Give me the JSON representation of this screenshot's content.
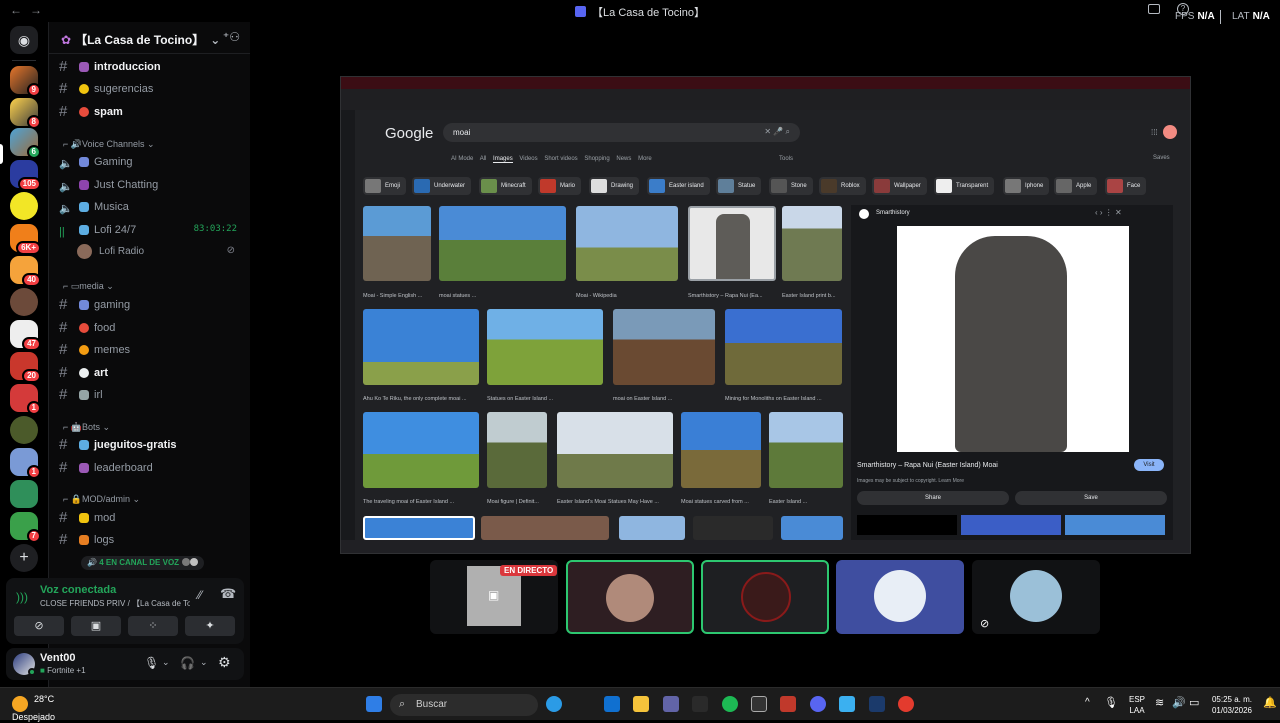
{
  "window": {
    "title": "【La Casa de Tocino】",
    "fps_label": "FPS",
    "fps_value": "N/A",
    "lat_label": "LAT",
    "lat_value": "N/A"
  },
  "rail_badges": [
    "9",
    "8",
    "6",
    "105",
    "6K+",
    "40",
    "47",
    "20",
    "1",
    "1",
    "7"
  ],
  "guild": {
    "name": "【La Casa de Tocino】"
  },
  "channels": {
    "introduccion": "introduccion",
    "sugerencias": "sugerencias",
    "spam": "spam",
    "voice_category": "Voice Channels",
    "gaming_voice": "Gaming",
    "just_chatting": "Just Chatting",
    "musica": "Musica",
    "lofi": "Lofi 24/7",
    "lofi_timer": "83:03:22",
    "lofi_radio": "Lofi Radio",
    "media_category": "media",
    "gaming_text": "gaming",
    "food": "food",
    "memes": "memes",
    "art": "art",
    "irl": "irl",
    "bots_category": "Bots",
    "jueguitos": "jueguitos-gratis",
    "leaderboard": "leaderboard",
    "mod_category": "MOD/admin",
    "mod": "mod",
    "logs": "logs",
    "voice_count": "4 EN CANAL DE VOZ"
  },
  "voice": {
    "status": "Voz conectada",
    "location": "CLOSE FRIENDS PRIV / 【La Casa de To..."
  },
  "user": {
    "name": "Vent00",
    "activity": "Fortnite +1"
  },
  "stream": {
    "live_label": "EN DIRECTO",
    "search_query": "moai",
    "google": "Google",
    "tabs": [
      "AI Mode",
      "All",
      "Images",
      "Videos",
      "Short videos",
      "Shopping",
      "News",
      "More",
      "Tools"
    ],
    "saves": "Saves",
    "chips": [
      "Emoji",
      "Underwater",
      "Minecraft",
      "Mario",
      "Drawing",
      "Easter island",
      "Statue",
      "Stone",
      "Roblox",
      "Wallpaper",
      "Transparent",
      "Iphone",
      "Apple",
      "Face"
    ],
    "row1": [
      "Moai - Simple English ...",
      "moai statues ...",
      "Moai - Wikipedia",
      "Smarthistory – Rapa Nui (Ea...",
      "Easter Island print b..."
    ],
    "row2": [
      "Ahu Ko Te Riku, the only complete moai ...",
      "Statues on Easter Island ...",
      "moai on Easter Island ...",
      "Mining for Monoliths on Easter Island ..."
    ],
    "row3": [
      "The traveling moai of Easter Island ...",
      "Moai figure | Definit...",
      "Easter Island's Moai Statues May Have ...",
      "Moai statues carved from ...",
      "Easter Island ..."
    ],
    "panel_source": "Smarthistory",
    "panel_title": "Smarthistory – Rapa Nui (Easter Island) Moai",
    "panel_note": "Images may be subject to copyright. Learn More",
    "visit": "Visit",
    "share": "Share",
    "save": "Save"
  },
  "taskbar": {
    "temp": "28°C",
    "weather": "Despejado",
    "search": "Buscar",
    "lang1": "ESP",
    "lang2": "LAA",
    "time": "05:25 a. m.",
    "date": "01/03/2026"
  },
  "colors": {
    "accent": "#5865f2",
    "speaking": "#2dc770",
    "live": "#da373c",
    "voice_green": "#23a55a"
  }
}
